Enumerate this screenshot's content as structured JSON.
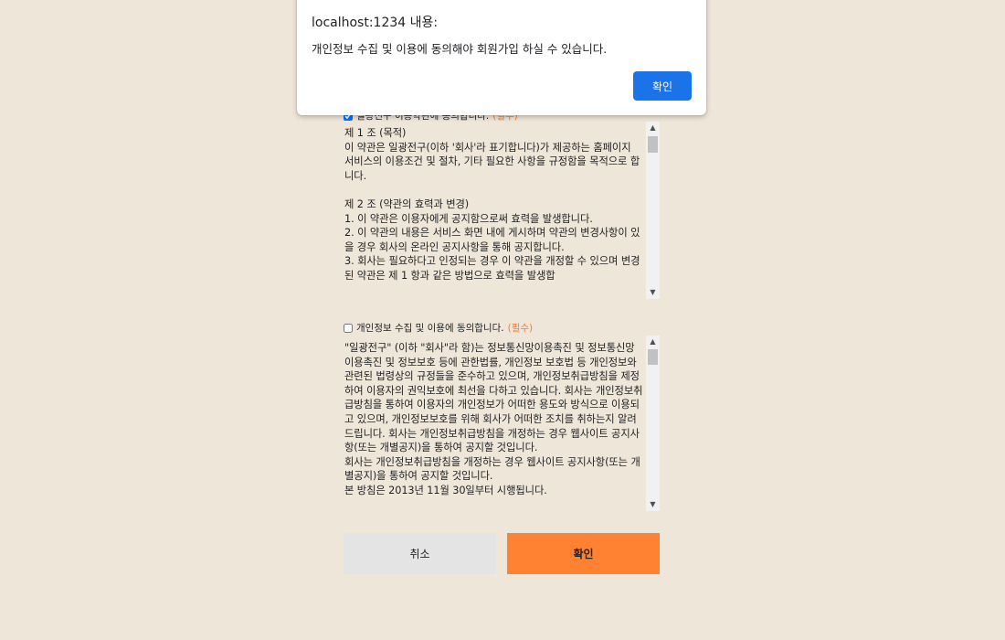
{
  "dialog": {
    "title": "localhost:1234 내용:",
    "message": "개인정보 수집 및 이용에 동의해야 회원가입 하실 수 있습니다.",
    "ok_label": "확인"
  },
  "terms": {
    "label": "일광전구 이용약관에 동의합니다.",
    "required": "(필수)",
    "checked": true,
    "text": "제 1 조 (목적)\n이 약관은 일광전구(이하 '회사'라 표기합니다)가 제공하는 홈페이지 서비스의 이용조건 및 절차, 기타 필요한 사항을 규정함을 목적으로 합니다.\n\n제 2 조 (약관의 효력과 변경)\n1. 이 약관은 이용자에게 공지함으로써 효력을 발생합니다.\n2. 이 약관의 내용은 서비스 화면 내에 게시하며 약관의 변경사항이 있을 경우 회사의 온라인 공지사항을 통해 공지합니다.\n3. 회사는 필요하다고 인정되는 경우 이 약관을 개정할 수 있으며 변경된 약관은 제 1 항과 같은 방법으로 효력을 발생합"
  },
  "privacy": {
    "label": "개인정보 수집 및 이용에 동의합니다.",
    "required": "(필수)",
    "checked": false,
    "text": "\"일광전구\" (이하 \"회사\"라 함)는 정보통신망이용촉진 및 정보통신망 이용촉진 및 정보보호 등에 관한법률, 개인정보 보호법 등 개인정보와 관련된 법령상의 규정들을 준수하고 있으며, 개인정보취급방침을 제정하여 이용자의 권익보호에 최선을 다하고 있습니다. 회사는 개인정보취급방침을 통하여 이용자의 개인정보가 어떠한 용도와 방식으로 이용되고 있으며, 개인정보보호를 위해 회사가 어떠한 조치를 취하는지 알려드립니다. 회사는 개인정보취급방침을 개정하는 경우 웹사이트 공지사항(또는 개별공지)을 통하여 공지할 것입니다.\n회사는 개인정보취급방침을 개정하는 경우 웹사이트 공지사항(또는 개별공지)을 통하여 공지할 것입니다.\n본 방침은 2013년 11월 30일부터 시행됩니다."
  },
  "buttons": {
    "cancel_label": "취소",
    "confirm_label": "확인"
  },
  "colors": {
    "background": "#efe6da",
    "accent": "#ff8232",
    "required": "#ff7a2a",
    "dialog_button": "#1a73e8"
  }
}
